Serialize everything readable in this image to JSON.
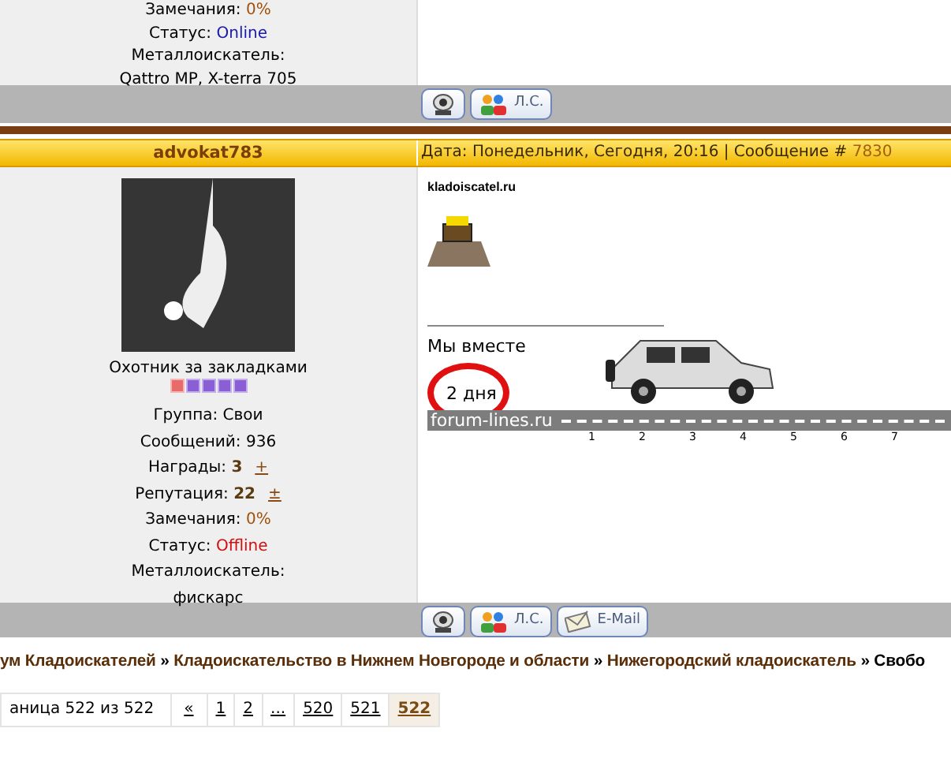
{
  "previous_post": {
    "profile": [
      {
        "label": "Замечания:",
        "value": "0%",
        "kind": "plain"
      },
      {
        "label": "Статус:",
        "value": "Online",
        "kind": "online"
      },
      {
        "label": "Металлоискатель:"
      },
      {
        "label": "Qattro MP, X-terra 705"
      }
    ],
    "actions": [
      {
        "kind": "webcam"
      },
      {
        "kind": "pm",
        "label": "Л.С."
      }
    ]
  },
  "post": {
    "author": "advokat783",
    "date": "Дата: Понедельник, Сегодня, 20:16 | Сообщение #",
    "number": "7830",
    "rank_title": "Охотник за закладками",
    "rank_pips": [
      {
        "color": "#e86a6a"
      },
      {
        "color": "#8a5fd6"
      },
      {
        "color": "#8a5fd6"
      },
      {
        "color": "#8a5fd6"
      },
      {
        "color": "#8a5fd6"
      }
    ],
    "profile": [
      {
        "label": "Группа: Свои"
      },
      {
        "label": "Сообщений: 936"
      },
      {
        "label": "Награды:",
        "value": "3",
        "kind": "bold",
        "action": "+"
      },
      {
        "label": "Репутация:",
        "value": "22",
        "kind": "bold",
        "action": "±"
      },
      {
        "label": "Замечания:",
        "value": "0%",
        "kind": "plain"
      },
      {
        "label": "Статус:",
        "value": "Offline",
        "kind": "offline"
      },
      {
        "label": "Металлоискатель:"
      },
      {
        "label": "фискарс"
      }
    ],
    "signature": {
      "site": "kladoiscatel.ru",
      "together_label": "Мы вместе",
      "days": "2 дня",
      "road_label": "forum-lines.ru",
      "ticks": [
        "1",
        "2",
        "3",
        "4",
        "5",
        "6",
        "7"
      ]
    },
    "actions": [
      {
        "kind": "webcam"
      },
      {
        "kind": "pm",
        "label": "Л.С."
      },
      {
        "kind": "email",
        "label": "E-Mail"
      }
    ]
  },
  "breadcrumb": [
    {
      "label": "ум Кладоискателей",
      "kind": "link"
    },
    {
      "label": "»",
      "kind": "sep"
    },
    {
      "label": "Кладоискательство в Нижнем Новгороде и области",
      "kind": "link"
    },
    {
      "label": "»",
      "kind": "sep"
    },
    {
      "label": "Нижегородский кладоискатель",
      "kind": "link"
    },
    {
      "label": "»",
      "kind": "sep"
    },
    {
      "label": "Свобо",
      "kind": "current"
    }
  ],
  "pagination": {
    "label": "аница 522 из 522",
    "pages": [
      {
        "label": "«",
        "selected": false
      },
      {
        "label": "1",
        "selected": false
      },
      {
        "label": "2",
        "selected": false
      },
      {
        "label": "...",
        "selected": false
      },
      {
        "label": "520",
        "selected": false
      },
      {
        "label": "521",
        "selected": false
      },
      {
        "label": "522",
        "selected": true
      }
    ]
  }
}
